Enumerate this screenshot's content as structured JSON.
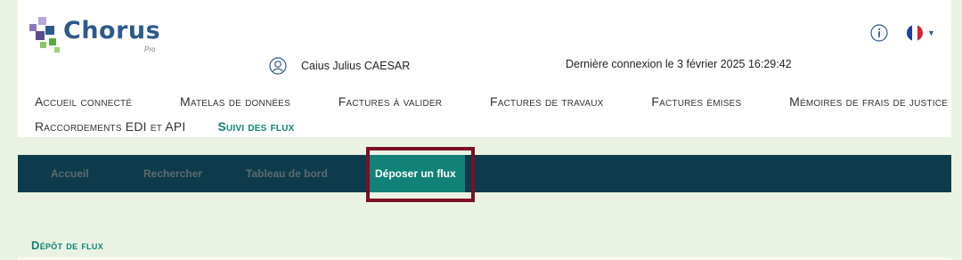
{
  "logo": {
    "name": "Chorus",
    "sub": "Pro"
  },
  "user": {
    "name": "Caius Julius CAESAR"
  },
  "last_connection": "Dernière connexion le 3 février 2025 16:29:42",
  "nav": {
    "row1": [
      "Accueil connecté",
      "Matelas de données",
      "Factures à valider",
      "Factures de travaux",
      "Factures émises",
      "Mémoires de frais de justice"
    ],
    "row2": [
      "Raccordements EDI et API",
      "Suivi des flux"
    ]
  },
  "subnav": [
    "Accueil",
    "Rechercher",
    "Tableau de bord",
    "Déposer un flux"
  ],
  "section_title": "Dépôt de flux",
  "icons": {
    "user": "user-icon",
    "info": "info-icon",
    "flag": "french-flag-icon",
    "caret": "caret-down-icon"
  },
  "colors": {
    "teal": "#128278",
    "navy": "#0d3b4b",
    "highlight": "#7b1025",
    "background": "#eaf3e3"
  }
}
